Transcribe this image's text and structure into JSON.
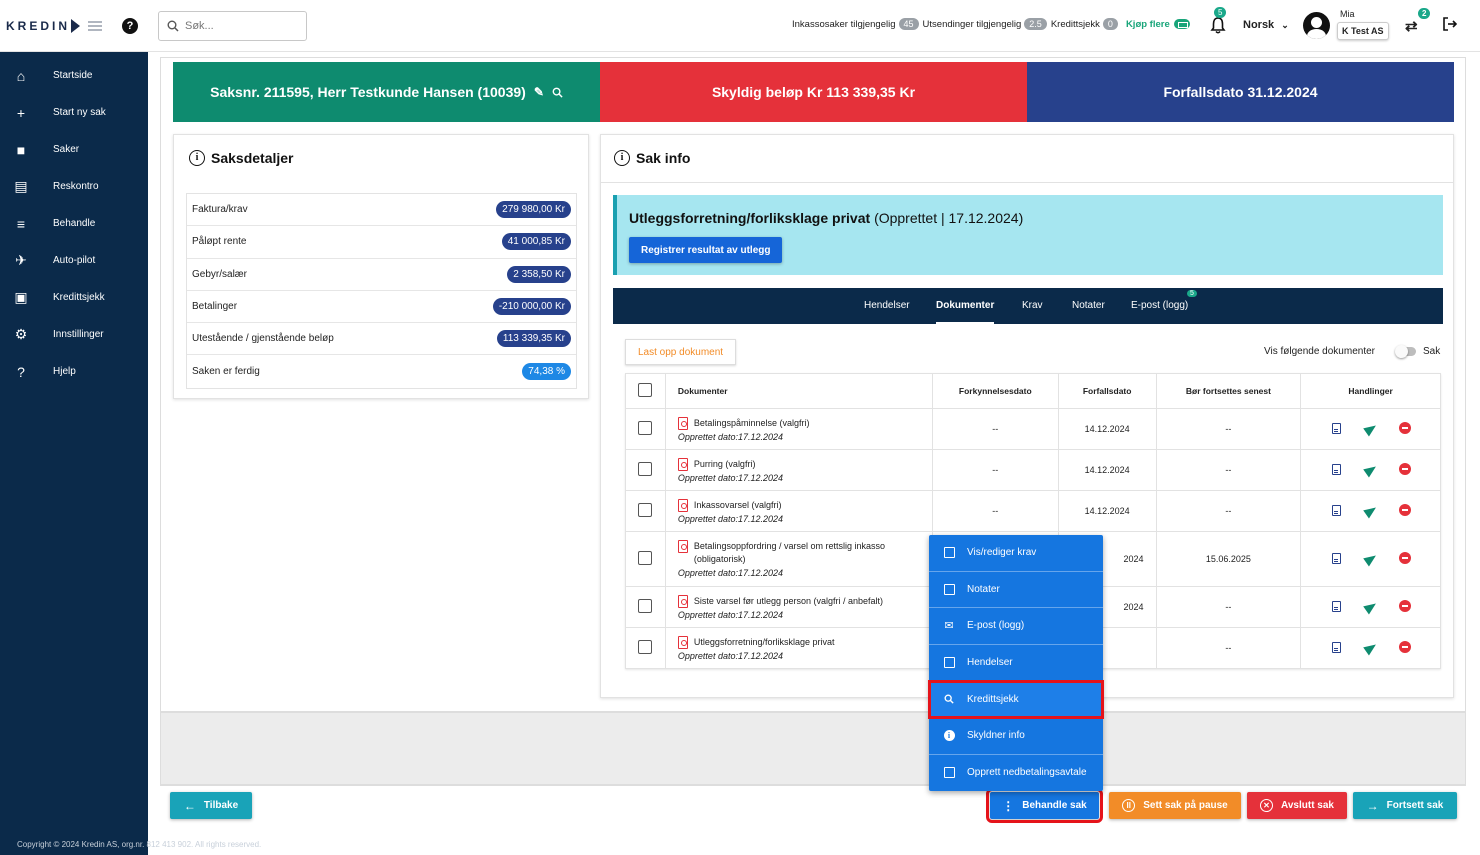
{
  "app": {
    "logo_text": "KREDIN",
    "help_label": "?",
    "search_placeholder": "Søk...",
    "stats": [
      {
        "label": "Inkassosaker tilgjengelig",
        "count": "45"
      },
      {
        "label": "Utsendinger tilgjengelig",
        "count": "2.5"
      },
      {
        "label": "Kredittsjekk",
        "count": "0"
      }
    ],
    "buy_more_label": "Kjøp flere",
    "notifications_count": "5",
    "language": "Norsk",
    "user_name": "Mia",
    "company": "K Test AS",
    "swap_badge": "2"
  },
  "sidebar": {
    "items": [
      {
        "label": "Startside",
        "icon": "home-icon"
      },
      {
        "label": "Start ny sak",
        "icon": "plus-icon"
      },
      {
        "label": "Saker",
        "icon": "briefcase-icon"
      },
      {
        "label": "Reskontro",
        "icon": "document-icon"
      },
      {
        "label": "Behandle",
        "icon": "checklist-icon"
      },
      {
        "label": "Auto-pilot",
        "icon": "airplane-icon"
      },
      {
        "label": "Kredittsjekk",
        "icon": "id-card-icon"
      },
      {
        "label": "Innstillinger",
        "icon": "gear-icon"
      },
      {
        "label": "Hjelp",
        "icon": "question-icon"
      }
    ]
  },
  "banners": {
    "case": "Saksnr. 211595,  Herr Testkunde Hansen (10039)",
    "owed": "Skyldig beløp Kr 113 339,35 Kr",
    "due": "Forfallsdato 31.12.2024"
  },
  "details": {
    "title": "Saksdetaljer",
    "rows": [
      {
        "label": "Faktura/krav",
        "value": "279 980,00 Kr"
      },
      {
        "label": "Påløpt rente",
        "value": "41 000,85 Kr"
      },
      {
        "label": "Gebyr/salær",
        "value": "2 358,50 Kr"
      },
      {
        "label": "Betalinger",
        "value": "-210 000,00 Kr"
      },
      {
        "label": "Utestående / gjenstående beløp",
        "value": "113 339,35 Kr"
      },
      {
        "label": "Saken er ferdig",
        "value": "74,38 %"
      }
    ]
  },
  "sakinfo": {
    "title": "Sak info",
    "status_title": "Utleggsforretning/forliksklage privat",
    "status_detail": "(Opprettet | 17.12.2024)",
    "register_button": "Registrer resultat av utlegg",
    "tabs": [
      {
        "label": "Hendelser"
      },
      {
        "label": "Dokumenter"
      },
      {
        "label": "Krav"
      },
      {
        "label": "Notater"
      },
      {
        "label": "E-post (logg)"
      }
    ],
    "email_badge": "5",
    "upload_button": "Last opp dokument",
    "toggle_label": "Vis følgende dokumenter",
    "toggle_side": "Sak",
    "columns": [
      "Dokumenter",
      "Forkynnelsesdato",
      "Forfallsdato",
      "Bør fortsettes senest",
      "Handlinger"
    ],
    "documents": [
      {
        "name": "Betalingspåminnelse (valgfri)",
        "created": "Opprettet dato:17.12.2024",
        "served": "--",
        "due": "14.12.2024",
        "latest": "--"
      },
      {
        "name": "Purring (valgfri)",
        "created": "Opprettet dato:17.12.2024",
        "served": "--",
        "due": "14.12.2024",
        "latest": "--"
      },
      {
        "name": "Inkassovarsel (valgfri)",
        "created": "Opprettet dato:17.12.2024",
        "served": "--",
        "due": "14.12.2024",
        "latest": "--"
      },
      {
        "name": "Betalingsoppfordring / varsel om rettslig inkasso (obligatorisk)",
        "created": "Opprettet dato:17.12.2024",
        "served": "",
        "due": "2024",
        "latest": "15.06.2025"
      },
      {
        "name": "Siste varsel før utlegg person (valgfri / anbefalt)",
        "created": "Opprettet dato:17.12.2024",
        "served": "",
        "due": "2024",
        "latest": "--"
      },
      {
        "name": "Utleggsforretning/forliksklage privat",
        "created": "Opprettet dato:17.12.2024",
        "served": "",
        "due": "--",
        "latest": "--"
      }
    ]
  },
  "menu": {
    "items": [
      {
        "label": "Vis/rediger krav",
        "icon": "calendar-x-icon"
      },
      {
        "label": "Notater",
        "icon": "note-add-icon"
      },
      {
        "label": "E-post (logg)",
        "icon": "mail-icon"
      },
      {
        "label": "Hendelser",
        "icon": "calendar-icon"
      },
      {
        "label": "Kredittsjekk",
        "icon": "search-icon"
      },
      {
        "label": "Skyldner info",
        "icon": "info-icon"
      },
      {
        "label": "Opprett nedbetalingsavtale",
        "icon": "document-icon"
      }
    ]
  },
  "actions": {
    "back": "Tilbake",
    "process": "Behandle sak",
    "pause": "Sett sak på pause",
    "end": "Avslutt sak",
    "continue": "Fortsett sak"
  },
  "footer": {
    "copyright": "Copyright © 2024 Kredin AS, org.nr. 812 413 902. All rights reserved."
  }
}
